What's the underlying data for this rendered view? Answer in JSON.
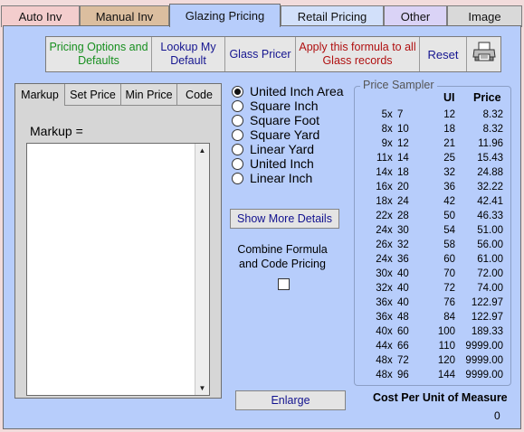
{
  "tabs": [
    {
      "label": "Auto Inv",
      "color": "#f3cdcd"
    },
    {
      "label": "Manual Inv",
      "color": "#dbbe9f"
    },
    {
      "label": "Glazing Pricing",
      "color": "#b7cdfb"
    },
    {
      "label": "Retail Pricing",
      "color": "#d2e0fa"
    },
    {
      "label": "Other",
      "color": "#dad3f6"
    },
    {
      "label": "Image",
      "color": "#d9d9d9"
    }
  ],
  "toolbar": {
    "pricing_options": "Pricing Options and Defaults",
    "pricing_options_color": "#178f1f",
    "lookup_default": "Lookup My Default",
    "glass_pricer": "Glass Pricer",
    "apply_formula": "Apply this formula to all Glass records",
    "apply_formula_color": "#b01010",
    "reset": "Reset",
    "print_icon": "printer-icon"
  },
  "formula_tabs": [
    "Markup",
    "Set Price",
    "Min Price",
    "Code"
  ],
  "markup_label": "Markup =",
  "markup_value": "",
  "units": [
    {
      "label": "United Inch Area",
      "selected": true
    },
    {
      "label": "Square Inch",
      "selected": false
    },
    {
      "label": "Square Foot",
      "selected": false
    },
    {
      "label": "Square Yard",
      "selected": false
    },
    {
      "label": "Linear Yard",
      "selected": false
    },
    {
      "label": "United Inch",
      "selected": false
    },
    {
      "label": "Linear Inch",
      "selected": false
    }
  ],
  "show_more_details": "Show More Details",
  "combine_label": "Combine Formula and Code Pricing",
  "combine_checked": false,
  "enlarge": "Enlarge",
  "sampler": {
    "title": "Price Sampler",
    "col_ui": "UI",
    "col_price": "Price",
    "separator": "x",
    "rows": [
      {
        "w": "5",
        "h": "7",
        "ui": "12",
        "price": "8.32"
      },
      {
        "w": "8",
        "h": "10",
        "ui": "18",
        "price": "8.32"
      },
      {
        "w": "9",
        "h": "12",
        "ui": "21",
        "price": "11.96"
      },
      {
        "w": "11",
        "h": "14",
        "ui": "25",
        "price": "15.43"
      },
      {
        "w": "14",
        "h": "18",
        "ui": "32",
        "price": "24.88"
      },
      {
        "w": "16",
        "h": "20",
        "ui": "36",
        "price": "32.22"
      },
      {
        "w": "18",
        "h": "24",
        "ui": "42",
        "price": "42.41"
      },
      {
        "w": "22",
        "h": "28",
        "ui": "50",
        "price": "46.33"
      },
      {
        "w": "24",
        "h": "30",
        "ui": "54",
        "price": "51.00"
      },
      {
        "w": "26",
        "h": "32",
        "ui": "58",
        "price": "56.00"
      },
      {
        "w": "24",
        "h": "36",
        "ui": "60",
        "price": "61.00"
      },
      {
        "w": "30",
        "h": "40",
        "ui": "70",
        "price": "72.00"
      },
      {
        "w": "32",
        "h": "40",
        "ui": "72",
        "price": "74.00"
      },
      {
        "w": "36",
        "h": "40",
        "ui": "76",
        "price": "122.97"
      },
      {
        "w": "36",
        "h": "48",
        "ui": "84",
        "price": "122.97"
      },
      {
        "w": "40",
        "h": "60",
        "ui": "100",
        "price": "189.33"
      },
      {
        "w": "44",
        "h": "66",
        "ui": "110",
        "price": "9999.00"
      },
      {
        "w": "48",
        "h": "72",
        "ui": "120",
        "price": "9999.00"
      },
      {
        "w": "48",
        "h": "96",
        "ui": "144",
        "price": "9999.00"
      }
    ]
  },
  "cost_label": "Cost Per Unit of Measure",
  "cost_value": "0"
}
